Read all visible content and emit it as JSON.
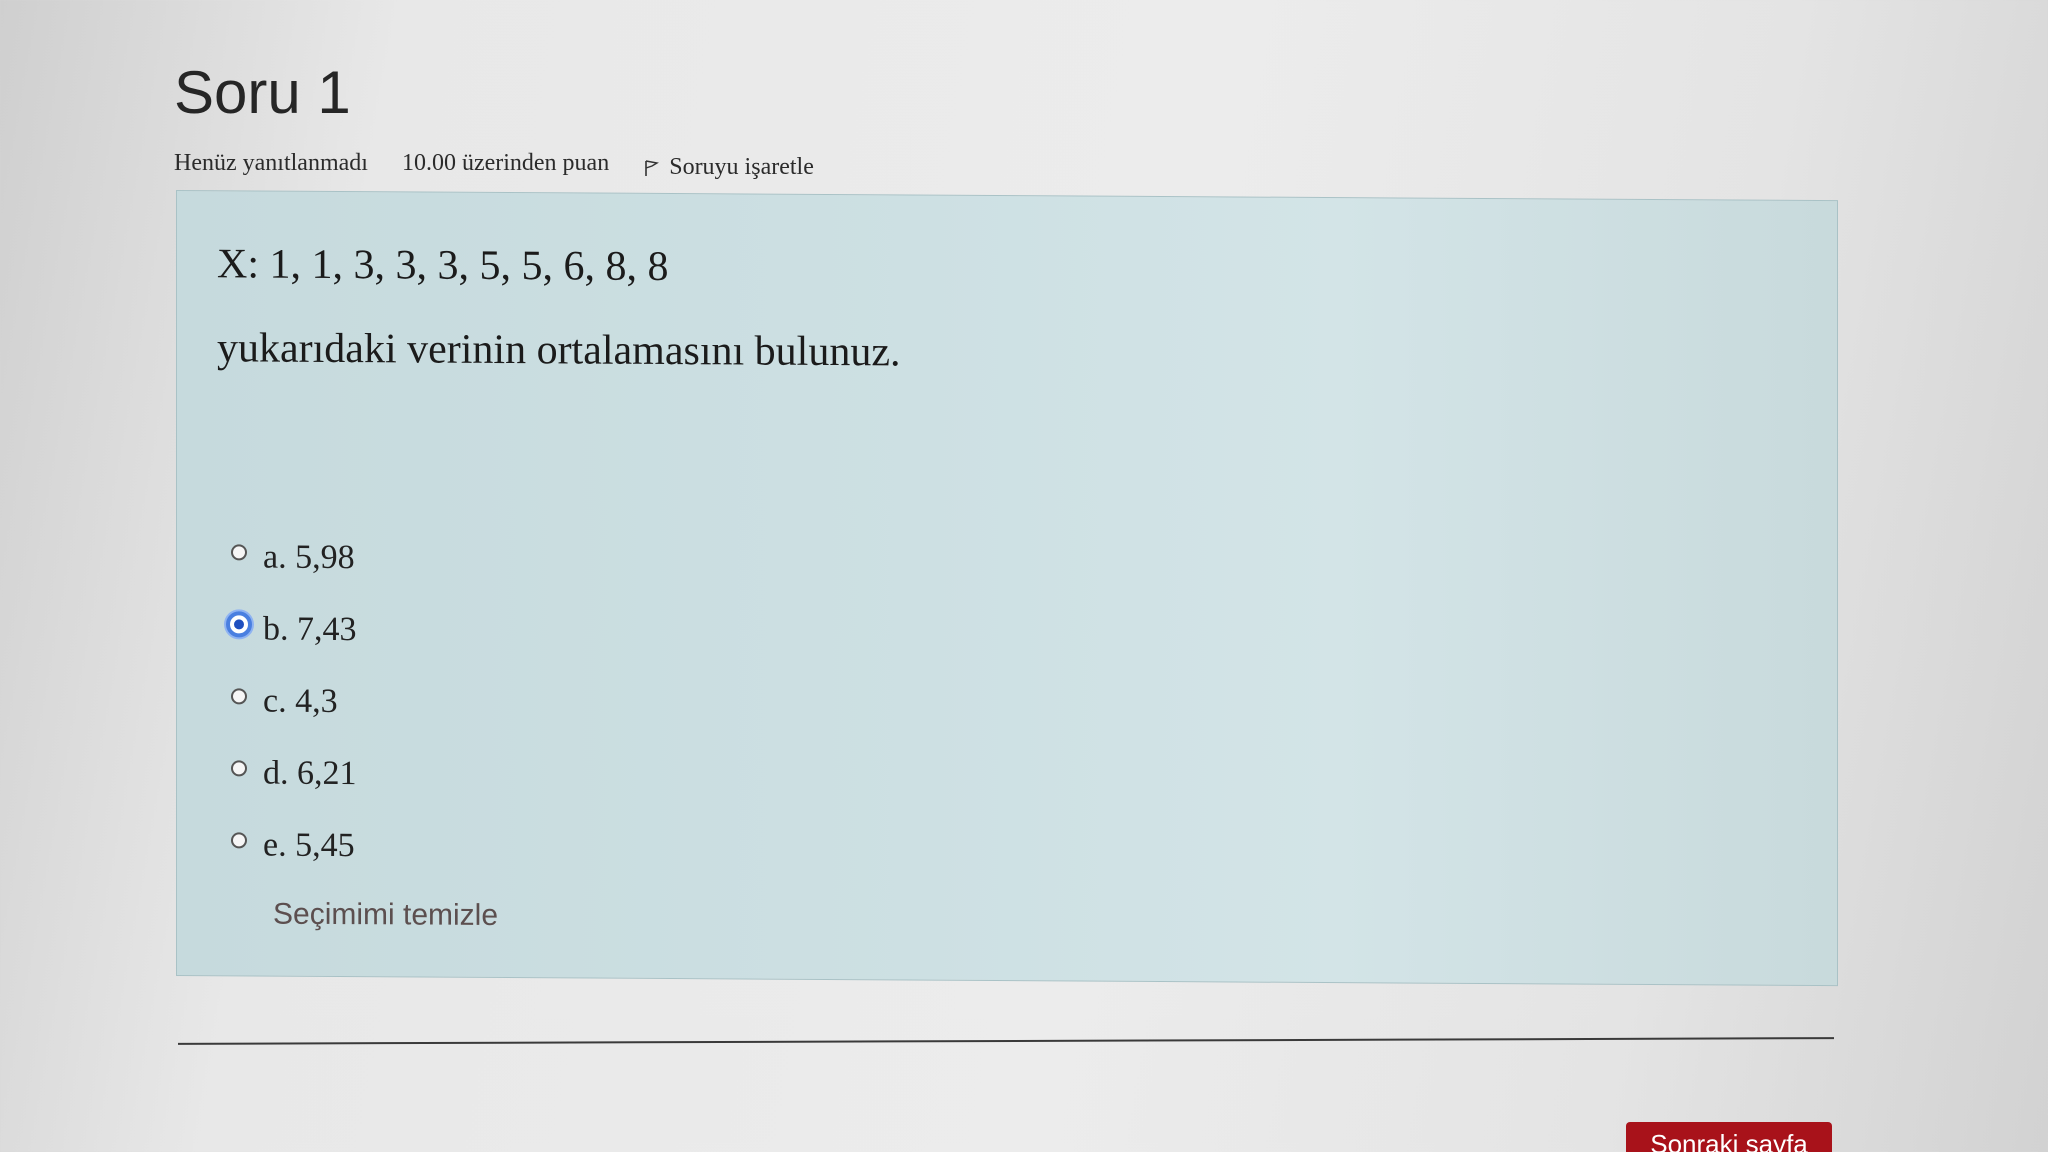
{
  "question": {
    "title": "Soru 1",
    "state": "Henüz yanıtlanmadı",
    "grade": "10.00 üzerinden puan",
    "flag_label": "Soruyu işaretle",
    "data_line": "X: 1, 1, 3, 3, 3, 5, 5, 6, 8, 8",
    "prompt": "yukarıdaki verinin ortalamasını bulunuz."
  },
  "answers": [
    {
      "label": "a. 5,98",
      "selected": false
    },
    {
      "label": "b. 7,43",
      "selected": true
    },
    {
      "label": "c. 4,3",
      "selected": false
    },
    {
      "label": "d. 6,21",
      "selected": false
    },
    {
      "label": "e. 5,45",
      "selected": false
    }
  ],
  "clear_label": "Seçimimi temizle",
  "next_button_label": "Sonraki sayfa",
  "colors": {
    "content_background": "#cde0e3",
    "selected_radio": "#4a7fe0",
    "next_button": "#a8121a"
  },
  "icons": {
    "flag": "flag-icon"
  }
}
